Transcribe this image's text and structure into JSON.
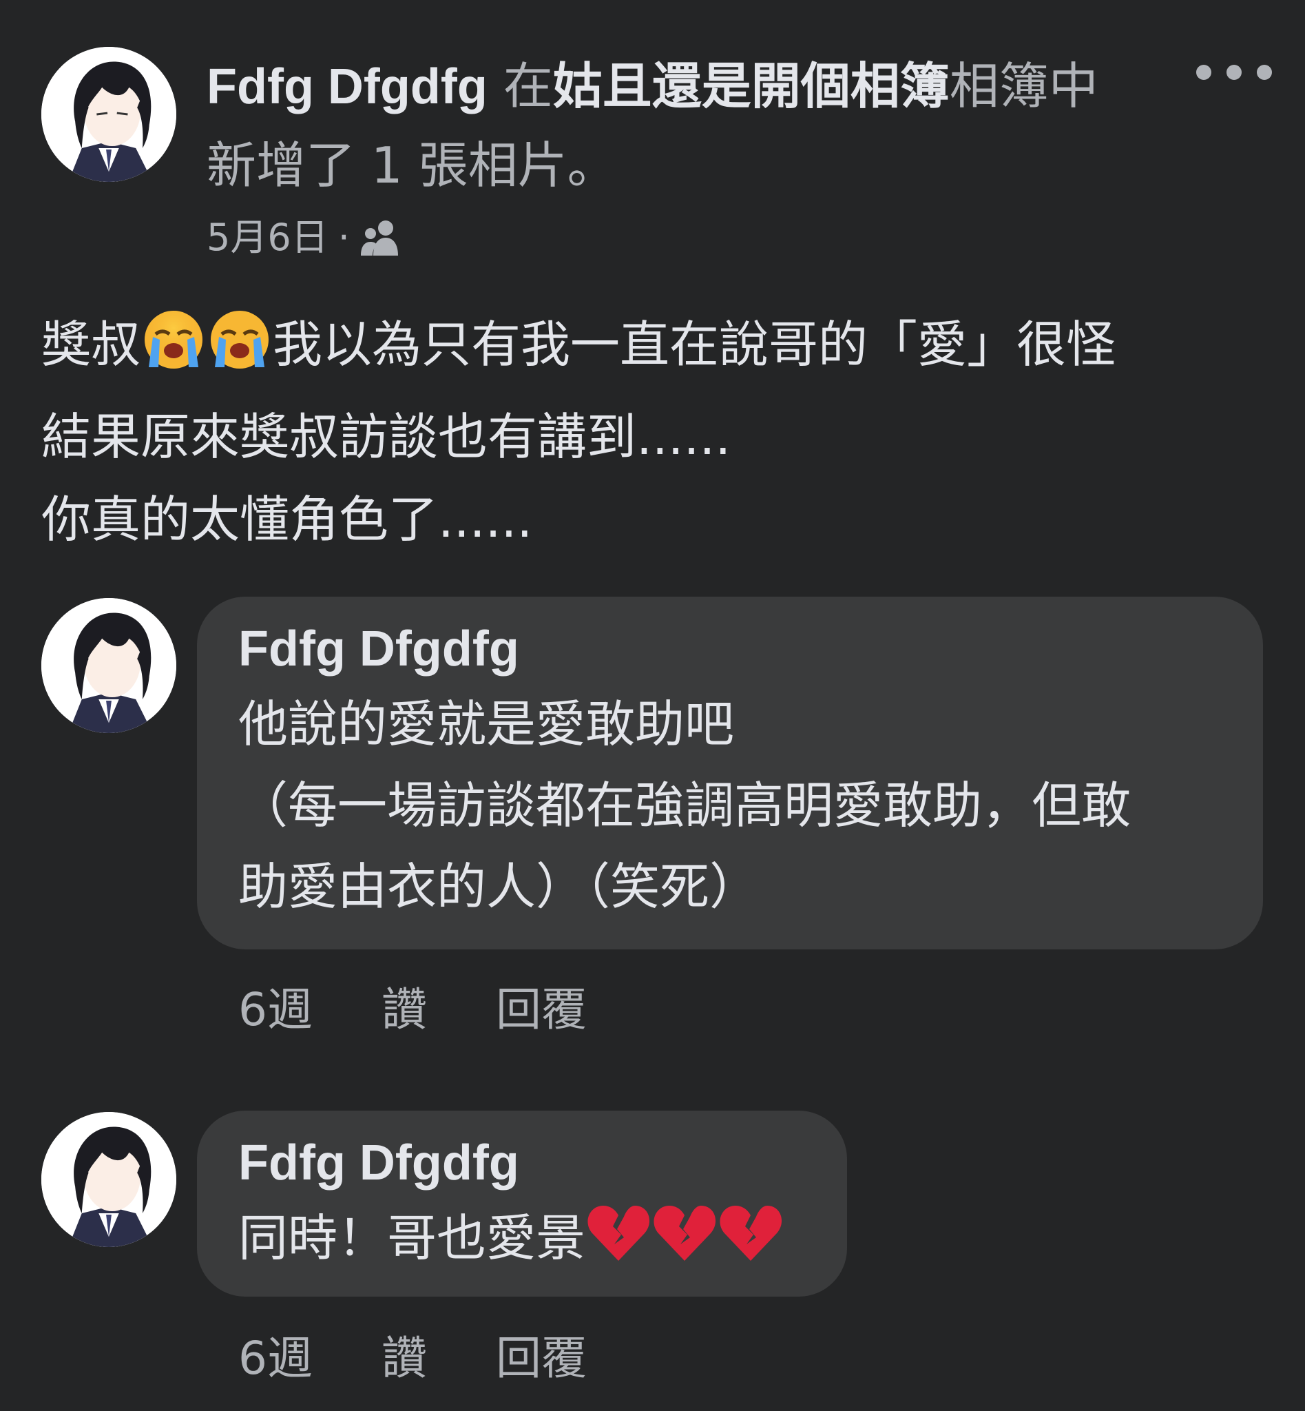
{
  "post": {
    "author": "Fdfg Dfgdfg",
    "header_prefix": " 在",
    "album": "姑且還是開個相簿",
    "header_suffix_1": "相簿中",
    "header_line2": "新增了 1 張相片。",
    "date": "5月6日",
    "separator": "·",
    "audience_icon": "friends-icon",
    "body_line1_a": "獎叔",
    "body_line1_b": "我以為只有我一直在說哥的「愛」很怪",
    "body_line2": "結果原來獎叔訪談也有講到......",
    "body_line3": "你真的太懂角色了......",
    "emojis_line1": [
      "loudly-crying-face",
      "loudly-crying-face"
    ]
  },
  "comments": [
    {
      "author": "Fdfg Dfgdfg",
      "lines": [
        "他說的愛就是愛敢助吧",
        "（每一場訪談都在強調高明愛敢助，但敢",
        "助愛由衣的人）（笑死）"
      ],
      "time": "6週",
      "like_label": "讚",
      "reply_label": "回覆"
    },
    {
      "author": "Fdfg Dfgdfg",
      "lines": [
        "同時！哥也愛景"
      ],
      "emojis": [
        "broken-heart",
        "broken-heart",
        "broken-heart"
      ],
      "time": "6週",
      "like_label": "讚",
      "reply_label": "回覆"
    }
  ],
  "colors": {
    "background": "#242526",
    "bubble": "#3a3b3c",
    "primary_text": "#e4e6eb",
    "secondary_text": "#b0b3b8"
  }
}
